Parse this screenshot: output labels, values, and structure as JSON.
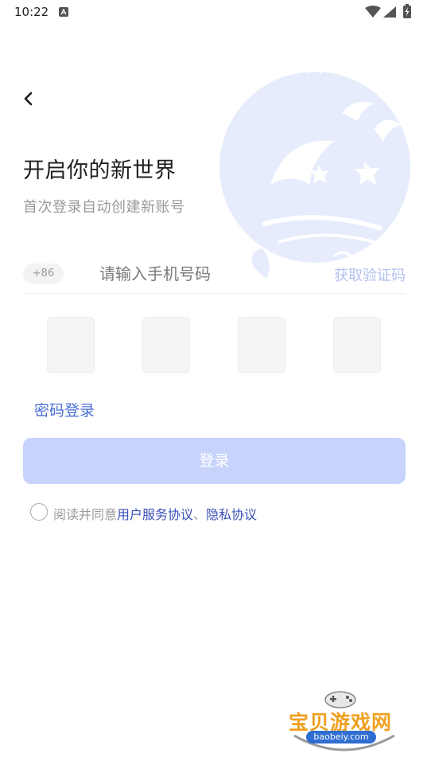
{
  "status_bar": {
    "time": "10:22"
  },
  "header": {
    "title": "开启你的新世界",
    "subtitle": "首次登录自动创建新账号"
  },
  "phone": {
    "country_code": "+86",
    "placeholder": "请输入手机号码",
    "value": "",
    "get_code_label": "获取验证码"
  },
  "verification": {
    "boxes": [
      "",
      "",
      "",
      ""
    ]
  },
  "password_login_label": "密码登录",
  "login_button_label": "登录",
  "agreement": {
    "prefix": "阅读并同意",
    "user_agreement": "用户服务协议",
    "separator": "、",
    "privacy_policy": "隐私协议",
    "checked": false
  },
  "watermark": {
    "title": "宝贝游戏网",
    "url": "baobeiy.com"
  },
  "colors": {
    "accent": "#4a6fd6",
    "button_disabled": "#c7d3fa",
    "get_code_disabled": "#b4c2ef",
    "link": "#3b4fb8",
    "illustration": "#e6ecfc"
  },
  "icons": {
    "back": "chevron-left-icon",
    "wifi": "wifi-icon",
    "signal": "signal-icon",
    "battery": "battery-icon",
    "notification": "notification-a-icon",
    "illustration": "whale-island-illustration",
    "radio": "radio-unchecked-icon"
  }
}
